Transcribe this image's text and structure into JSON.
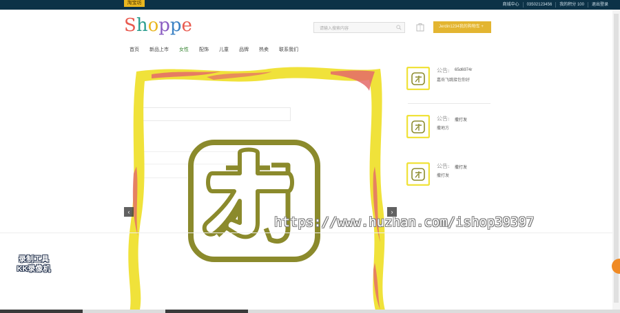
{
  "topbar": {
    "badge": "淘宝坊",
    "links": [
      "商城中心",
      "03502123456",
      "我的积分 100",
      "退出登录"
    ]
  },
  "header": {
    "logo": "Shoppe",
    "search_placeholder": "请输入搜索内容",
    "cart_button": "Jerdin1234我的购物车 +"
  },
  "nav": {
    "items": [
      "首页",
      "新品上市",
      "女性",
      "配饰",
      "儿童",
      "品牌",
      "热卖",
      "联系我们"
    ]
  },
  "slider": {
    "prev": "‹",
    "next": "›"
  },
  "notices": [
    {
      "label": "公告:",
      "title": "65d6974r",
      "desc": "嘉岳飞跳接包你好"
    },
    {
      "label": "公告:",
      "title": "撒打发",
      "desc": "撒地方"
    },
    {
      "label": "公告:",
      "title": "撒打发",
      "desc": "撒打发"
    }
  ],
  "overlay": {
    "url_watermark": "https://www.huzhan.com/ishop39397",
    "recorder_line1": "录制工具",
    "recorder_line2": "KK录像机"
  },
  "colors": {
    "topbar": "#0c3247",
    "accent": "#e3b531",
    "frame_yellow": "#f0e23a",
    "frame_red": "#e46a6a",
    "icon_olive": "#8b8a2c"
  }
}
